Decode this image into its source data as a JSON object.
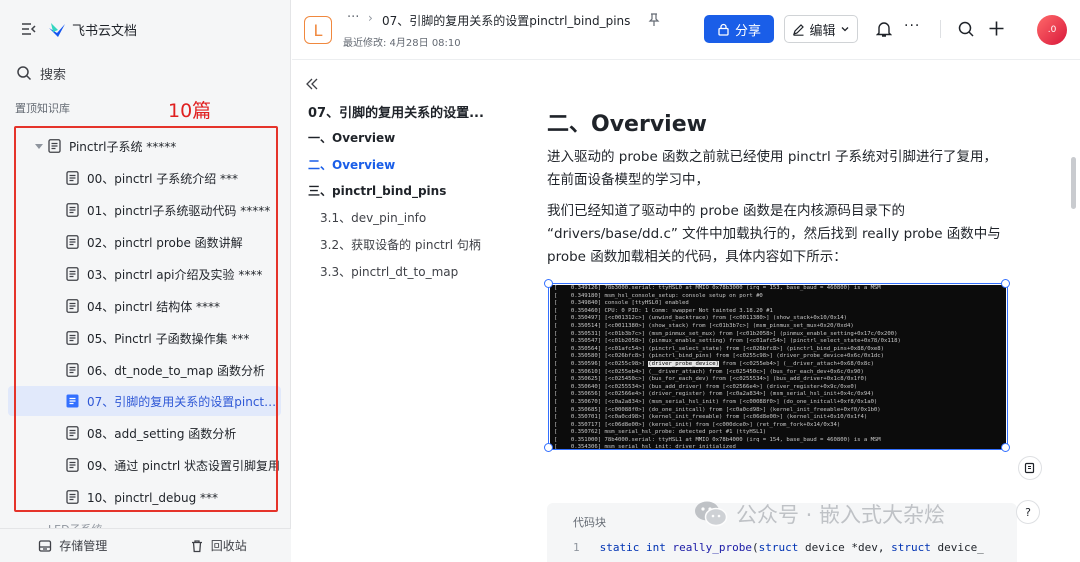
{
  "sidebar": {
    "brand": "飞书云文档",
    "search_label": "搜索",
    "section_title": "置顶知识库",
    "annotation_count": "10篇",
    "tree": {
      "root": "Pinctrl子系统 *****",
      "children": [
        "00、pinctrl 子系统介绍 ***",
        "01、pinctrl子系统驱动代码 *****",
        "02、pinctrl probe 函数讲解",
        "03、pinctrl api介绍及实验 ****",
        "04、pinctrl 结构体 ****",
        "05、Pinctrl 子函数操作集 ***",
        "06、dt_node_to_map 函数分析",
        "07、引脚的复用关系的设置pinctrl_bind_pins",
        "08、add_setting 函数分析",
        "09、通过 pinctrl 状态设置引脚复用",
        "10、pinctrl_debug ***"
      ]
    },
    "partial_item": "LED子系统",
    "footer": {
      "storage": "存储管理",
      "recycle": "回收站"
    }
  },
  "topbar": {
    "doc_badge": "L",
    "more": "···",
    "breadcrumb_sep": "›",
    "title": "07、引脚的复用关系的设置pinctrl_bind_pins",
    "last_modified": "最近修改: 4月28日 08:10",
    "share_label": "分享",
    "edit_label": "编辑",
    "more_dots": "···",
    "avatar": ".0"
  },
  "outline": {
    "title": "07、引脚的复用关系的设置...",
    "items": [
      {
        "text": "一、Overview"
      },
      {
        "text": "二、Overview"
      },
      {
        "text": "三、pinctrl_bind_pins"
      },
      {
        "text": "3.1、dev_pin_info"
      },
      {
        "text": "3.2、获取设备的 pinctrl 句柄"
      },
      {
        "text": "3.3、pinctrl_dt_to_map"
      }
    ]
  },
  "document": {
    "heading": "二、Overview",
    "para1": "进入驱动的 probe 函数之前就已经使用 pinctrl 子系统对引脚进行了复用，在前面设备模型的学习中，",
    "para2": " 我们已经知道了驱动中的 probe 函数是在内核源码目录下的 “drivers/base/dd.c” 文件中加载执行的，然后找到 really probe 函数中与 probe 函数加载相关的代码，具体内容如下所示：",
    "terminal_lines": [
      "[    0.349126] 78b3000.serial: ttyHSL0 at MMIO 0x78b3000 (irq = 153, base_baud = 460800) is a MSM",
      "[    0.349180] msm_hsl_console_setup: console setup on port #0",
      "[    0.349840] console [ttyHSL0] enabled",
      "[    0.350460] CPU: 0 PID: 1 Comm: swapper Not tainted 3.18.20 #1",
      "[    0.350497] [<c001312c>] (unwind_backtrace) from [<c0011380>] (show_stack+0x10/0x14)",
      "[    0.350514] [<c0011380>] (show_stack) from [<c01b3b7c>] (msm_pinmux_set_mux+0x20/0xd4)",
      "[    0.350531] [<c01b3b7c>] (msm_pinmux_set_mux) from [<c01b2058>] (pinmux_enable_setting+0x17c/0x200)",
      "[    0.350547] [<c01b2058>] (pinmux_enable_setting) from [<c01afc54>] (pinctrl_select_state+0x78/0x118)",
      "[    0.350564] [<c01afc54>] (pinctrl_select_state) from [<c026bfc8>] (pinctrl_bind_pins+0x88/0xe8)",
      "[    0.350580] [<c026bfc8>] (pinctrl_bind_pins) from [<c0255c98>] (driver_probe_device+0x6c/0x1dc)",
      "[    0.350596] [<c0255c98>] (driver_probe_device) from [<c0255eb4>] (__driver_attach+0x68/0x8c)",
      "[    0.350610] [<c0255eb4>] (__driver_attach) from [<c025450c>] (bus_for_each_dev+0x6c/0x90)",
      "[    0.350625] [<c025450c>] (bus_for_each_dev) from [<c0255534>] (bus_add_driver+0x1c8/0x1f0)",
      "[    0.350640] [<c0255534>] (bus_add_driver) from [<c02566e4>] (driver_register+0x9c/0xe0)",
      "[    0.350656] [<c02566e4>] (driver_register) from [<c0a2a834>] (msm_serial_hsl_init+0x4c/0x94)",
      "[    0.350670] [<c0a2a834>] (msm_serial_hsl_init) from [<c00088f0>] (do_one_initcall+0xf8/0x1a0)",
      "[    0.350685] [<c00088f0>] (do_one_initcall) from [<c0a0cd98>] (kernel_init_freeable+0xf0/0x1b0)",
      "[    0.350701] [<c0a0cd98>] (kernel_init_freeable) from [<c06d8e00>] (kernel_init+0x10/0x1f4)",
      "[    0.350717] [<c06d8e00>] (kernel_init) from [<c000dce0>] (ret_from_fork+0x14/0x34)",
      "[    0.350762] msm_serial_hsl_probe: detected port #1 (ttyHSL1)",
      "[    0.351000] 78b4000.serial: ttyHSL1 at MMIO 0x78b4000 (irq = 154, base_baud = 460800) is a MSM",
      "[    0.354306] msm_serial_hsl_init: driver initialized"
    ],
    "code_label": "代码块",
    "code_line_no": "1",
    "code_kw1": "static",
    "code_kw2": "int",
    "code_fn": "really_probe",
    "code_rest1": "(",
    "code_kw3": "struct",
    "code_rest2": " device *dev, ",
    "code_kw4": "struct",
    "code_rest3": " device_"
  },
  "watermark": "公众号 · 嵌入式大杂烩",
  "float_help": "?",
  "colors": {
    "accent": "#1a5ee8",
    "annotation_red": "#e5332a",
    "active_bg": "#e1e9fb"
  }
}
